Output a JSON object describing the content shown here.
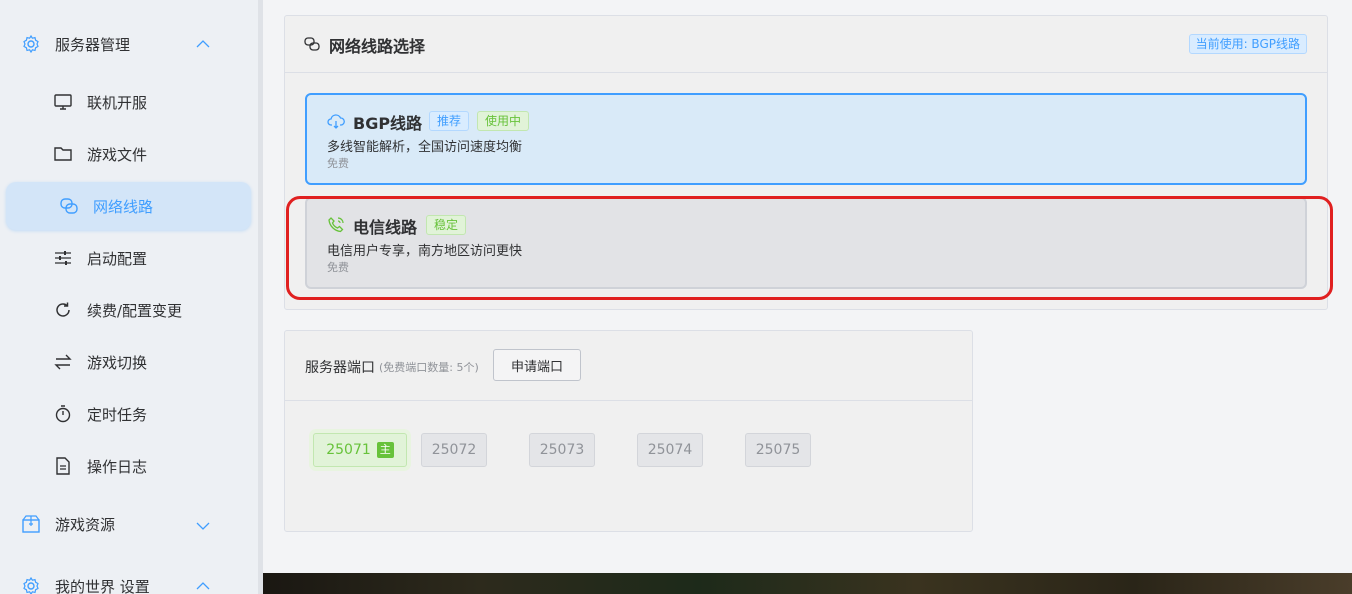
{
  "sidebar": {
    "groups": [
      {
        "label": "服务器管理",
        "icon": "gear-icon",
        "expanded": true
      },
      {
        "label": "游戏资源",
        "icon": "box-icon",
        "expanded": false
      },
      {
        "label": "我的世界 设置",
        "icon": "gear-icon",
        "expanded": true
      }
    ],
    "items": [
      {
        "label": "联机开服",
        "icon": "monitor-icon"
      },
      {
        "label": "游戏文件",
        "icon": "folder-icon"
      },
      {
        "label": "网络线路",
        "icon": "link-icon",
        "active": true
      },
      {
        "label": "启动配置",
        "icon": "sliders-icon"
      },
      {
        "label": "续费/配置变更",
        "icon": "refresh-icon"
      },
      {
        "label": "游戏切换",
        "icon": "switch-icon"
      },
      {
        "label": "定时任务",
        "icon": "timer-icon"
      },
      {
        "label": "操作日志",
        "icon": "document-icon"
      }
    ]
  },
  "network": {
    "title": "网络线路选择",
    "current_badge": "当前使用: BGP线路",
    "routes": [
      {
        "name": "BGP线路",
        "tags": [
          "推荐",
          "使用中"
        ],
        "desc": "多线智能解析，全国访问速度均衡",
        "price": "免费",
        "selected": true,
        "icon": "cloud-icon"
      },
      {
        "name": "电信线路",
        "tags": [
          "稳定"
        ],
        "desc": "电信用户专享，南方地区访问更快",
        "price": "免费",
        "selected": false,
        "icon": "phone-icon"
      }
    ]
  },
  "ports": {
    "title": "服务器端口",
    "note": "(免费端口数量: 5个)",
    "apply_label": "申请端口",
    "list": [
      {
        "value": "25071",
        "primary": true,
        "badge": "主"
      },
      {
        "value": "25072",
        "primary": false
      },
      {
        "value": "25073",
        "primary": false
      },
      {
        "value": "25074",
        "primary": false
      },
      {
        "value": "25075",
        "primary": false
      }
    ]
  },
  "colors": {
    "accent": "#409eff",
    "success": "#67c23a",
    "highlight": "#e02020"
  }
}
